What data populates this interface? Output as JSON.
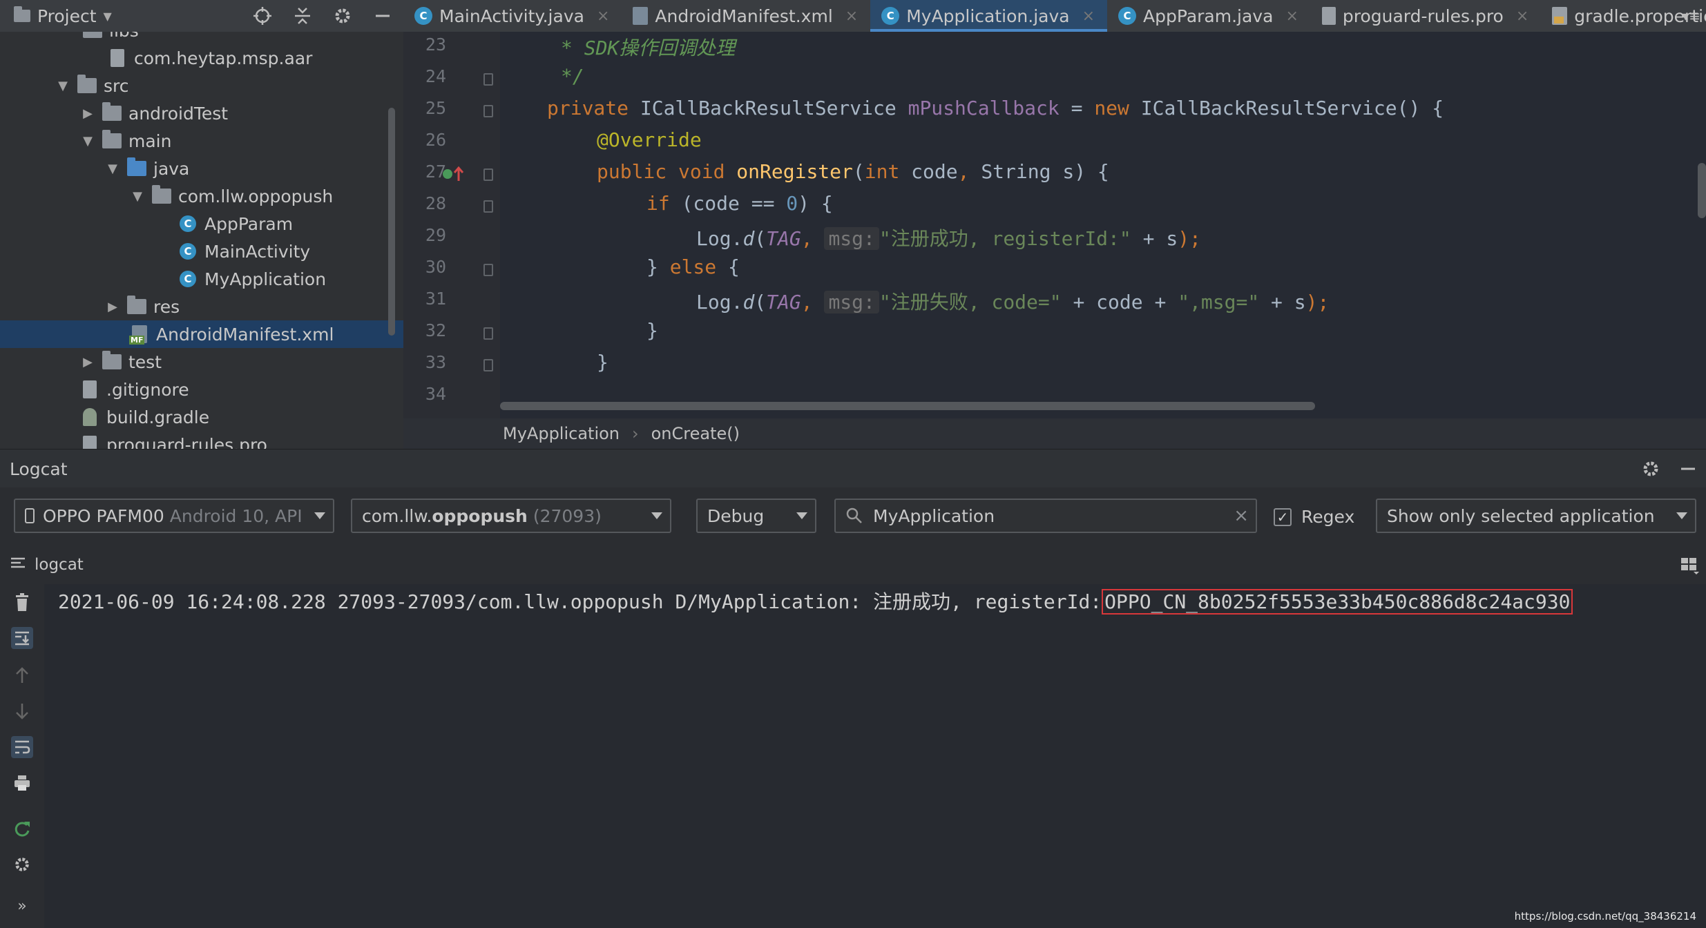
{
  "project_panel": {
    "title": "Project",
    "tree": [
      {
        "label": "libs",
        "indent": 0
      },
      {
        "label": "com.heytap.msp.aar",
        "indent": 1
      },
      {
        "label": "src",
        "indent": 0
      },
      {
        "label": "androidTest",
        "indent": 1
      },
      {
        "label": "main",
        "indent": 1
      },
      {
        "label": "java",
        "indent": 2
      },
      {
        "label": "com.llw.oppopush",
        "indent": 3
      },
      {
        "label": "AppParam",
        "indent": 4
      },
      {
        "label": "MainActivity",
        "indent": 4
      },
      {
        "label": "MyApplication",
        "indent": 4
      },
      {
        "label": "res",
        "indent": 2
      },
      {
        "label": "AndroidManifest.xml",
        "indent": 2
      },
      {
        "label": "test",
        "indent": 1
      },
      {
        "label": ".gitignore",
        "indent": 0
      },
      {
        "label": "build.gradle",
        "indent": 0
      },
      {
        "label": "proguard-rules.pro",
        "indent": 0
      }
    ]
  },
  "tabs": [
    {
      "label": "MainActivity.java"
    },
    {
      "label": "AndroidManifest.xml"
    },
    {
      "label": "MyApplication.java"
    },
    {
      "label": "AppParam.java"
    },
    {
      "label": "proguard-rules.pro"
    },
    {
      "label": "gradle.properties"
    }
  ],
  "tabs_menu": "▾≡",
  "editor": {
    "line_numbers": [
      "23",
      "24",
      "25",
      "26",
      "27",
      "28",
      "29",
      "30",
      "31",
      "32",
      "33",
      "34"
    ],
    "code": {
      "l23": "* SDK操作回调处理",
      "l24": "*/",
      "l25_kw": "private ",
      "l25_type": "ICallBackResultService ",
      "l25_field": "mPushCallback",
      "l25_eq": " = ",
      "l25_new": "new ",
      "l25_rest": "ICallBackResultService() {",
      "l26": "@Override",
      "l27_kw": "public void ",
      "l27_fn": "onRegister",
      "l27_p1": "(",
      "l27_int": "int ",
      "l27_code": "code",
      "l27_comma": ", ",
      "l27_rest": "String s) {",
      "l28_if": "if ",
      "l28_a": "(code == ",
      "l28_num": "0",
      "l28_b": ") {",
      "l29_a": "Log.",
      "l29_d": "d",
      "l29_b": "(",
      "l29_tag": "TAG",
      "l29_c": ", ",
      "l29_hint": "msg:",
      "l29_str": "\"注册成功, registerId:\"",
      "l29_e": " + s",
      "l29_end": ");",
      "l30_a": "} ",
      "l30_else": "else ",
      "l30_b": "{",
      "l31_a": "Log.",
      "l31_d": "d",
      "l31_b": "(",
      "l31_tag": "TAG",
      "l31_c": ", ",
      "l31_hint": "msg:",
      "l31_str1": "\"注册失败, code=\"",
      "l31_mid": " + code + ",
      "l31_str2": "\",msg=\"",
      "l31_e": " + s",
      "l31_end": ");",
      "l32": "}",
      "l33": "}"
    },
    "breadcrumb": [
      "MyApplication",
      "onCreate()"
    ]
  },
  "logcat": {
    "title": "Logcat",
    "device": {
      "name": "OPPO PAFM00",
      "detail": "Android 10, API"
    },
    "process": {
      "prefix": "com.llw.",
      "name": "oppopush",
      "pid": "(27093)"
    },
    "level": "Debug",
    "search": "MyApplication",
    "regex_label": "Regex",
    "regex_checked": true,
    "filter": "Show only selected application",
    "subbar_label": "logcat",
    "log_line_prefix": "2021-06-09 16:24:08.228 27093-27093/com.llw.oppopush D/MyApplication: 注册成功, registerId:",
    "log_line_highlight": "OPPO_CN_8b0252f5553e33b450c886d8c24ac930"
  },
  "watermark": "https://blog.csdn.net/qq_38436214",
  "colors": {
    "accent": "#4a88c7",
    "highlight_box": "#d8373a",
    "selection": "#1f3e63"
  }
}
